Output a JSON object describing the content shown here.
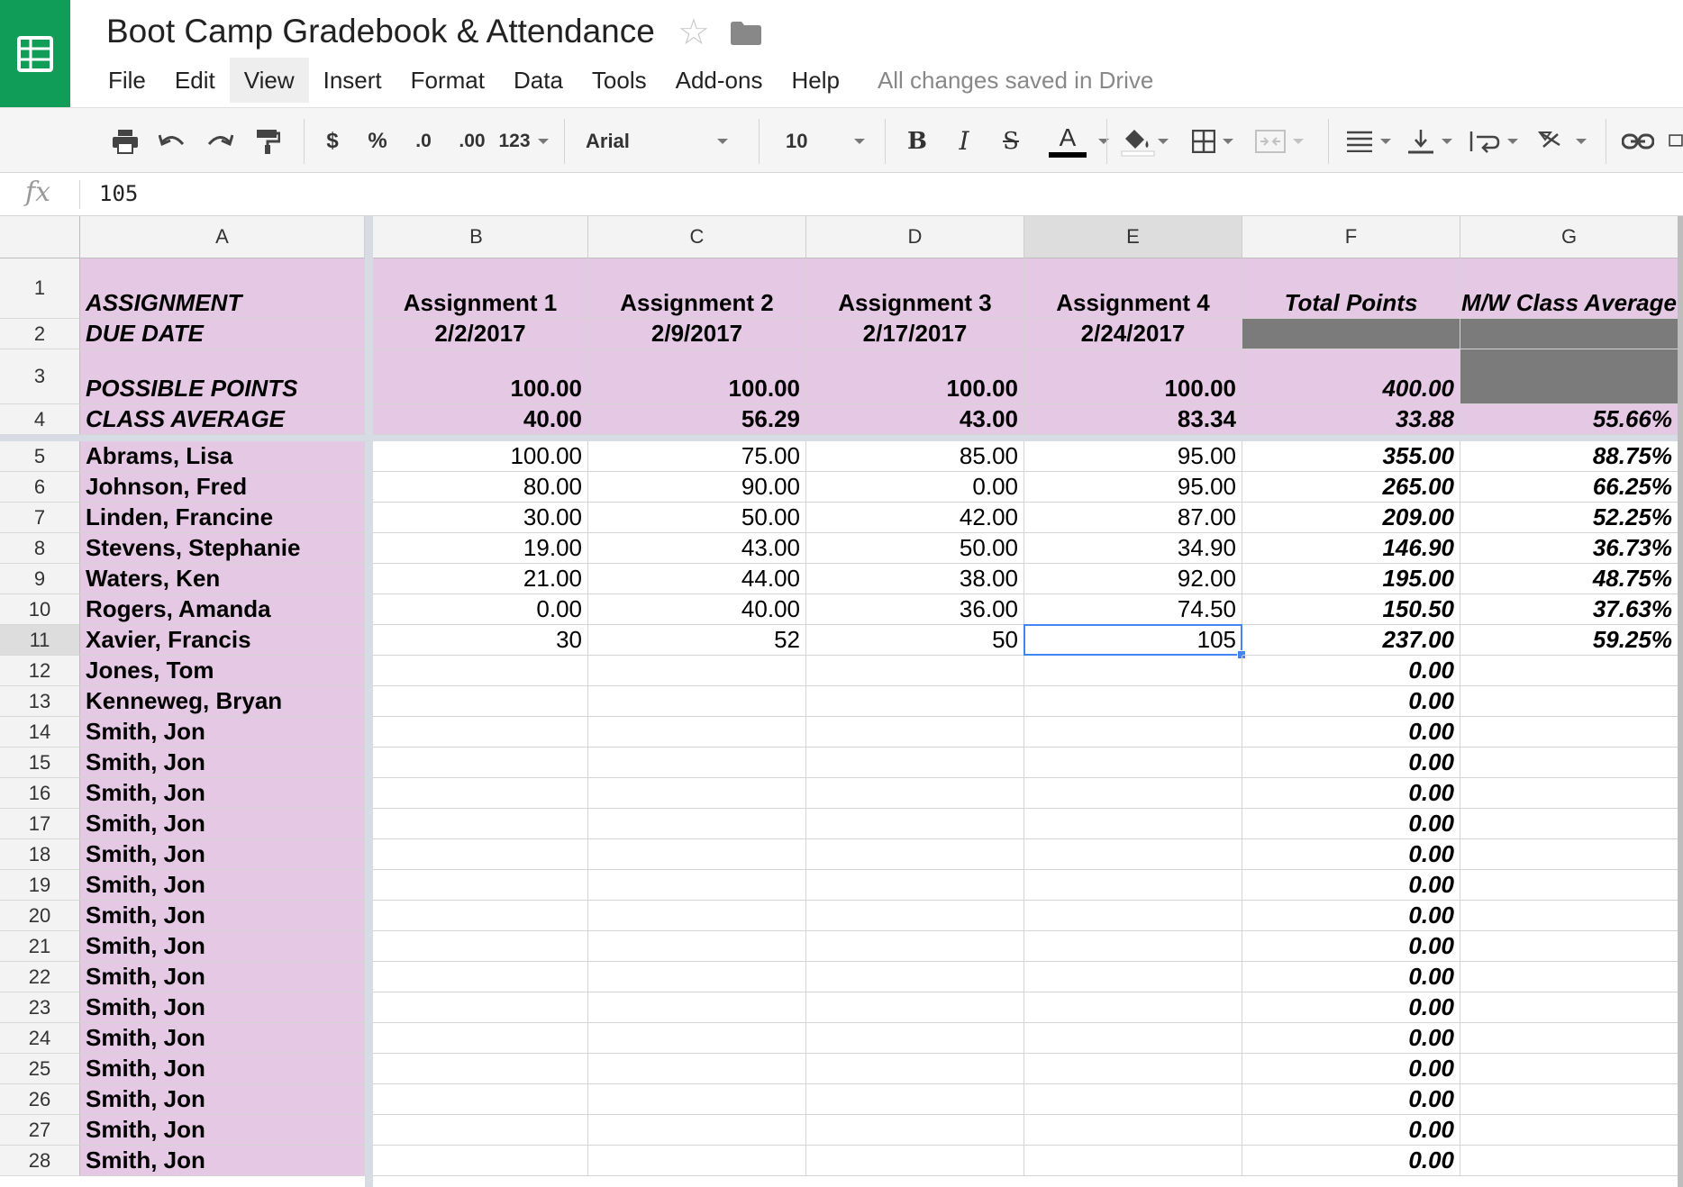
{
  "app": {
    "title": "Boot Camp Gradebook & Attendance",
    "save_status": "All changes saved in Drive",
    "accent_color": "#0f9d58"
  },
  "menu": [
    "File",
    "Edit",
    "View",
    "Insert",
    "Format",
    "Data",
    "Tools",
    "Add-ons",
    "Help"
  ],
  "menu_active": "View",
  "toolbar": {
    "currency": "$",
    "percent": "%",
    "dec_decrease": ".0",
    "dec_increase": ".00",
    "more_formats": "123",
    "font": "Arial",
    "font_size": "10",
    "bold": "B",
    "italic": "I",
    "strike": "S",
    "text_color": "A"
  },
  "formula_bar": {
    "fx": "fx",
    "value": "105"
  },
  "columns": [
    "A",
    "B",
    "C",
    "D",
    "E",
    "F",
    "G"
  ],
  "selected_column": "E",
  "selected_row": "11",
  "rows": [
    {
      "n": "1",
      "cells": [
        "ASSIGNMENT",
        "Assignment 1",
        "Assignment 2",
        "Assignment 3",
        "Assignment 4",
        "Total Points",
        "M/W Class Average"
      ]
    },
    {
      "n": "2",
      "cells": [
        "DUE DATE",
        "2/2/2017",
        "2/9/2017",
        "2/17/2017",
        "2/24/2017",
        "",
        ""
      ]
    },
    {
      "n": "3",
      "cells": [
        "POSSIBLE POINTS",
        "100.00",
        "100.00",
        "100.00",
        "100.00",
        "400.00",
        ""
      ]
    },
    {
      "n": "4",
      "cells": [
        "CLASS AVERAGE",
        "40.00",
        "56.29",
        "43.00",
        "83.34",
        "33.88",
        "55.66%"
      ]
    },
    {
      "n": "5",
      "cells": [
        "Abrams, Lisa",
        "100.00",
        "75.00",
        "85.00",
        "95.00",
        "355.00",
        "88.75%"
      ]
    },
    {
      "n": "6",
      "cells": [
        "Johnson, Fred",
        "80.00",
        "90.00",
        "0.00",
        "95.00",
        "265.00",
        "66.25%"
      ]
    },
    {
      "n": "7",
      "cells": [
        "Linden, Francine",
        "30.00",
        "50.00",
        "42.00",
        "87.00",
        "209.00",
        "52.25%"
      ]
    },
    {
      "n": "8",
      "cells": [
        "Stevens, Stephanie",
        "19.00",
        "43.00",
        "50.00",
        "34.90",
        "146.90",
        "36.73%"
      ]
    },
    {
      "n": "9",
      "cells": [
        "Waters, Ken",
        "21.00",
        "44.00",
        "38.00",
        "92.00",
        "195.00",
        "48.75%"
      ]
    },
    {
      "n": "10",
      "cells": [
        "Rogers, Amanda",
        "0.00",
        "40.00",
        "36.00",
        "74.50",
        "150.50",
        "37.63%"
      ]
    },
    {
      "n": "11",
      "cells": [
        "Xavier, Francis",
        "30",
        "52",
        "50",
        "105",
        "237.00",
        "59.25%"
      ]
    },
    {
      "n": "12",
      "cells": [
        "Jones, Tom",
        "",
        "",
        "",
        "",
        "0.00",
        ""
      ]
    },
    {
      "n": "13",
      "cells": [
        "Kenneweg, Bryan",
        "",
        "",
        "",
        "",
        "0.00",
        ""
      ]
    },
    {
      "n": "14",
      "cells": [
        "Smith, Jon",
        "",
        "",
        "",
        "",
        "0.00",
        ""
      ]
    },
    {
      "n": "15",
      "cells": [
        "Smith, Jon",
        "",
        "",
        "",
        "",
        "0.00",
        ""
      ]
    },
    {
      "n": "16",
      "cells": [
        "Smith, Jon",
        "",
        "",
        "",
        "",
        "0.00",
        ""
      ]
    },
    {
      "n": "17",
      "cells": [
        "Smith, Jon",
        "",
        "",
        "",
        "",
        "0.00",
        ""
      ]
    },
    {
      "n": "18",
      "cells": [
        "Smith, Jon",
        "",
        "",
        "",
        "",
        "0.00",
        ""
      ]
    },
    {
      "n": "19",
      "cells": [
        "Smith, Jon",
        "",
        "",
        "",
        "",
        "0.00",
        ""
      ]
    },
    {
      "n": "20",
      "cells": [
        "Smith, Jon",
        "",
        "",
        "",
        "",
        "0.00",
        ""
      ]
    },
    {
      "n": "21",
      "cells": [
        "Smith, Jon",
        "",
        "",
        "",
        "",
        "0.00",
        ""
      ]
    },
    {
      "n": "22",
      "cells": [
        "Smith, Jon",
        "",
        "",
        "",
        "",
        "0.00",
        ""
      ]
    },
    {
      "n": "23",
      "cells": [
        "Smith, Jon",
        "",
        "",
        "",
        "",
        "0.00",
        ""
      ]
    },
    {
      "n": "24",
      "cells": [
        "Smith, Jon",
        "",
        "",
        "",
        "",
        "0.00",
        ""
      ]
    },
    {
      "n": "25",
      "cells": [
        "Smith, Jon",
        "",
        "",
        "",
        "",
        "0.00",
        ""
      ]
    },
    {
      "n": "26",
      "cells": [
        "Smith, Jon",
        "",
        "",
        "",
        "",
        "0.00",
        ""
      ]
    },
    {
      "n": "27",
      "cells": [
        "Smith, Jon",
        "",
        "",
        "",
        "",
        "0.00",
        ""
      ]
    },
    {
      "n": "28",
      "cells": [
        "Smith, Jon",
        "",
        "",
        "",
        "",
        "0.00",
        ""
      ]
    }
  ],
  "colors": {
    "header_fill": "#e5c9e4",
    "blocked_fill": "#7b7b7b",
    "selection": "#4285f4"
  }
}
